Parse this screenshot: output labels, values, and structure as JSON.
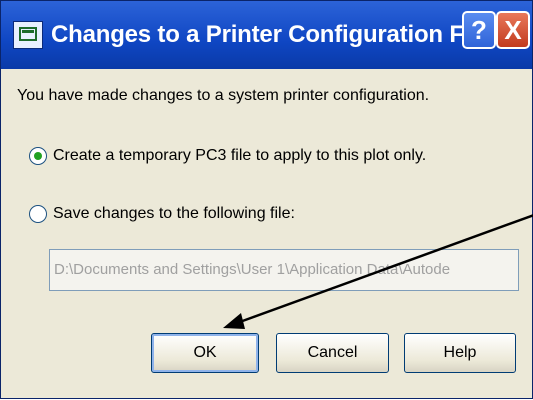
{
  "dialog": {
    "title": "Changes to a Printer Configuration File",
    "help_glyph": "?",
    "close_glyph": "X",
    "message": "You have made changes to a system printer configuration.",
    "options": [
      {
        "label": "Create a temporary PC3 file to apply to this plot only.",
        "selected": true
      },
      {
        "label": "Save changes to the following file:",
        "selected": false
      }
    ],
    "file_path": "D:\\Documents and Settings\\User 1\\Application Data\\Autode",
    "buttons": {
      "ok": "OK",
      "cancel": "Cancel",
      "help": "Help"
    }
  },
  "icons": [
    "printer-config-app-icon",
    "help-icon",
    "close-icon",
    "annotation-arrow"
  ],
  "colors": {
    "titlebar": "#0f46c3",
    "dialog_bg": "#ece9d8",
    "close": "#c23b1e",
    "radio_selected": "#21a121"
  }
}
